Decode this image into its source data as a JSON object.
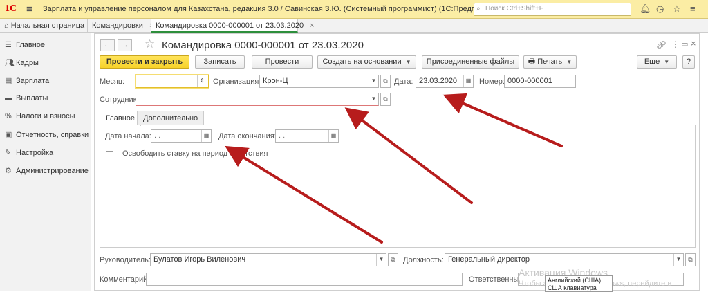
{
  "titlebar": {
    "logo": "1С",
    "title": "Зарплата и управление персоналом для Казахстана, редакция 3.0 / Савинская З.Ю. (Системный программист)  (1С:Предприятие)",
    "search_placeholder": "Поиск Ctrl+Shift+F"
  },
  "tabs": [
    {
      "label": "Начальная страница"
    },
    {
      "label": "Командировки"
    },
    {
      "label": "Командировка 0000-000001 от 23.03.2020"
    }
  ],
  "sidebar": {
    "items": [
      {
        "label": "Главное",
        "icon": "menu-icon"
      },
      {
        "label": "Кадры",
        "icon": "people-icon"
      },
      {
        "label": "Зарплата",
        "icon": "wallet-icon"
      },
      {
        "label": "Выплаты",
        "icon": "payments-icon"
      },
      {
        "label": "Налоги и взносы",
        "icon": "percent-icon"
      },
      {
        "label": "Отчетность, справки",
        "icon": "reports-icon"
      },
      {
        "label": "Настройка",
        "icon": "wrench-icon"
      },
      {
        "label": "Администрирование",
        "icon": "gear-icon"
      }
    ]
  },
  "document": {
    "title": "Командировка 0000-000001 от 23.03.2020",
    "toolbar": {
      "post_close": "Провести и закрыть",
      "save": "Записать",
      "post": "Провести",
      "create_based": "Создать на основании",
      "attached_files": "Присоединенные файлы",
      "print": "Печать",
      "more": "Еще",
      "help": "?"
    },
    "fields": {
      "month_label": "Месяц:",
      "month_value": "",
      "org_label": "Организация:",
      "org_value": "Крон-Ц",
      "date_label": "Дата:",
      "date_value": "23.03.2020",
      "number_label": "Номер:",
      "number_value": "0000-000001",
      "employee_label": "Сотрудник:",
      "employee_value": ""
    },
    "inner_tabs": [
      {
        "label": "Главное"
      },
      {
        "label": "Дополнительно"
      }
    ],
    "main_tab": {
      "start_label": "Дата начала:",
      "start_value": " .  .",
      "end_label": "Дата окончания:",
      "end_value": " .  .",
      "release_rate_label": "Освободить ставку на период отсутствия"
    },
    "footer": {
      "manager_label": "Руководитель:",
      "manager_value": "Булатов Игорь Виленович",
      "position_label": "Должность:",
      "position_value": "Генеральный директор",
      "comment_label": "Комментарий:",
      "comment_value": "",
      "responsible_label": "Ответственный:"
    }
  },
  "overlay": {
    "watermark_line1": "Активация Windows",
    "watermark_line2": "Чтобы активировать Windows, перейдите в",
    "lang_line1": "Английский (США)",
    "lang_line2": "США клавиатура"
  },
  "colors": {
    "titlebar_bg": "#fbeda4",
    "primary_button": "#f7d22a",
    "arrow": "#b71c1c"
  }
}
